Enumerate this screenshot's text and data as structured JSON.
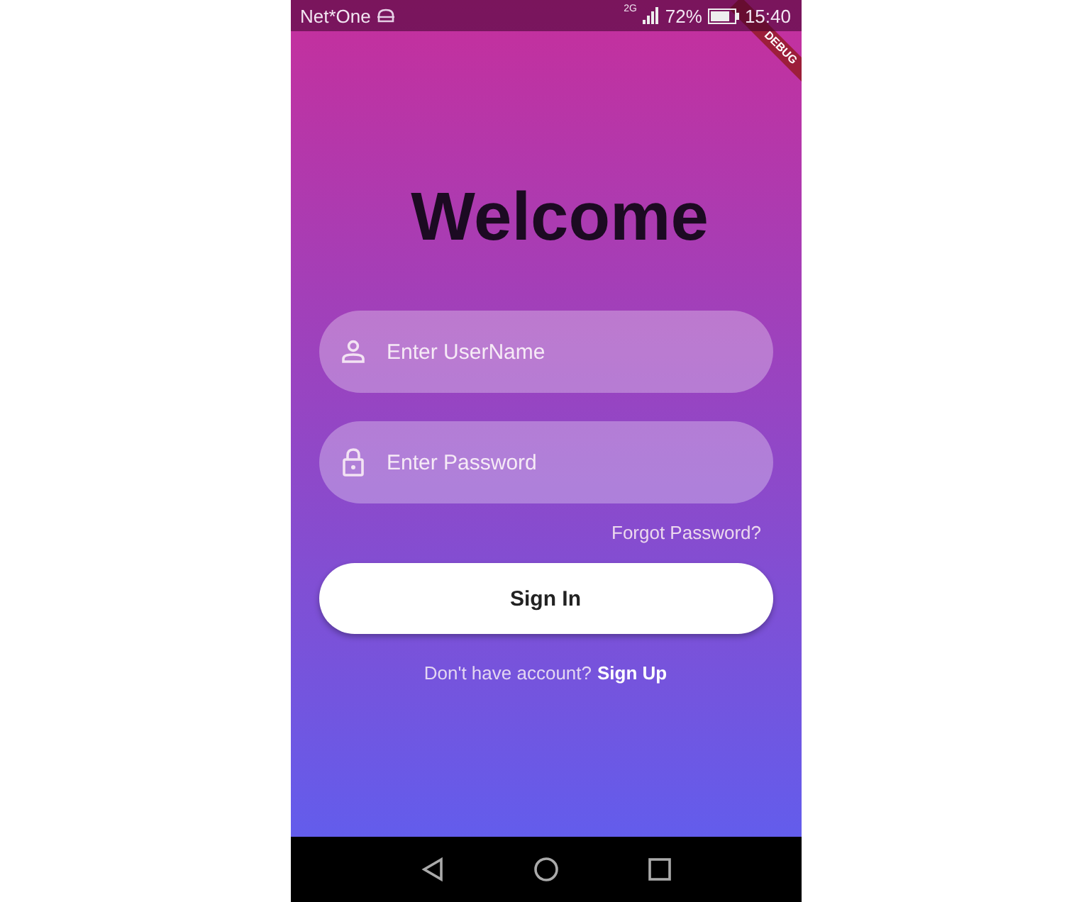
{
  "status_bar": {
    "carrier": "Net*One",
    "network": "2G",
    "battery": "72%",
    "time": "15:40"
  },
  "debug_banner": "DEBUG",
  "title": "Welcome",
  "fields": [
    {
      "kind": "user",
      "placeholder": "Enter UserName"
    },
    {
      "kind": "lock",
      "placeholder": "Enter Password"
    }
  ],
  "forgot_link": "Forgot Password?",
  "sign_in_button": "Sign In",
  "signup_prompt": {
    "text": "Don't have account?",
    "link": "Sign Up"
  }
}
